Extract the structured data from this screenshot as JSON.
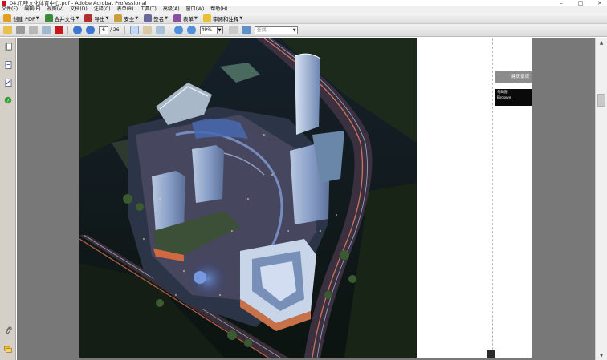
{
  "window": {
    "title": "04.爪哇文化体育中心.pdf - Adobe Acrobat Professional",
    "minimize": "–",
    "maximize": "□",
    "close": "✕"
  },
  "menu": [
    "文件(F)",
    "编辑(E)",
    "视图(V)",
    "文档(D)",
    "注释(C)",
    "表单(R)",
    "工具(T)",
    "高级(A)",
    "窗口(W)",
    "帮助(H)"
  ],
  "toolbar1": {
    "create_pdf": "创建 PDF",
    "combine_files": "合并文件",
    "export": "导出",
    "secure": "安全",
    "sign": "签名",
    "forms": "表单",
    "review_comment": "审阅和注释"
  },
  "toolbar2": {
    "current_page": "6",
    "total_pages": "/ 26",
    "zoom": "49%",
    "search_placeholder": "查找"
  },
  "document": {
    "tab_text": "建筑景观",
    "black_label_cn": "鸟瞰图",
    "black_label_en": "Birdseye"
  },
  "colors": {
    "acrobat_red": "#c8161d",
    "doc_background": "#787878",
    "panel_gray": "#d4d0c8"
  },
  "icons": {
    "pages_panel": "pages-icon",
    "bookmarks_panel": "bookmarks-icon",
    "signatures_panel": "signatures-icon",
    "how_to_panel": "help-icon",
    "attachments_panel": "paperclip-icon",
    "comments_panel": "comments-icon"
  }
}
